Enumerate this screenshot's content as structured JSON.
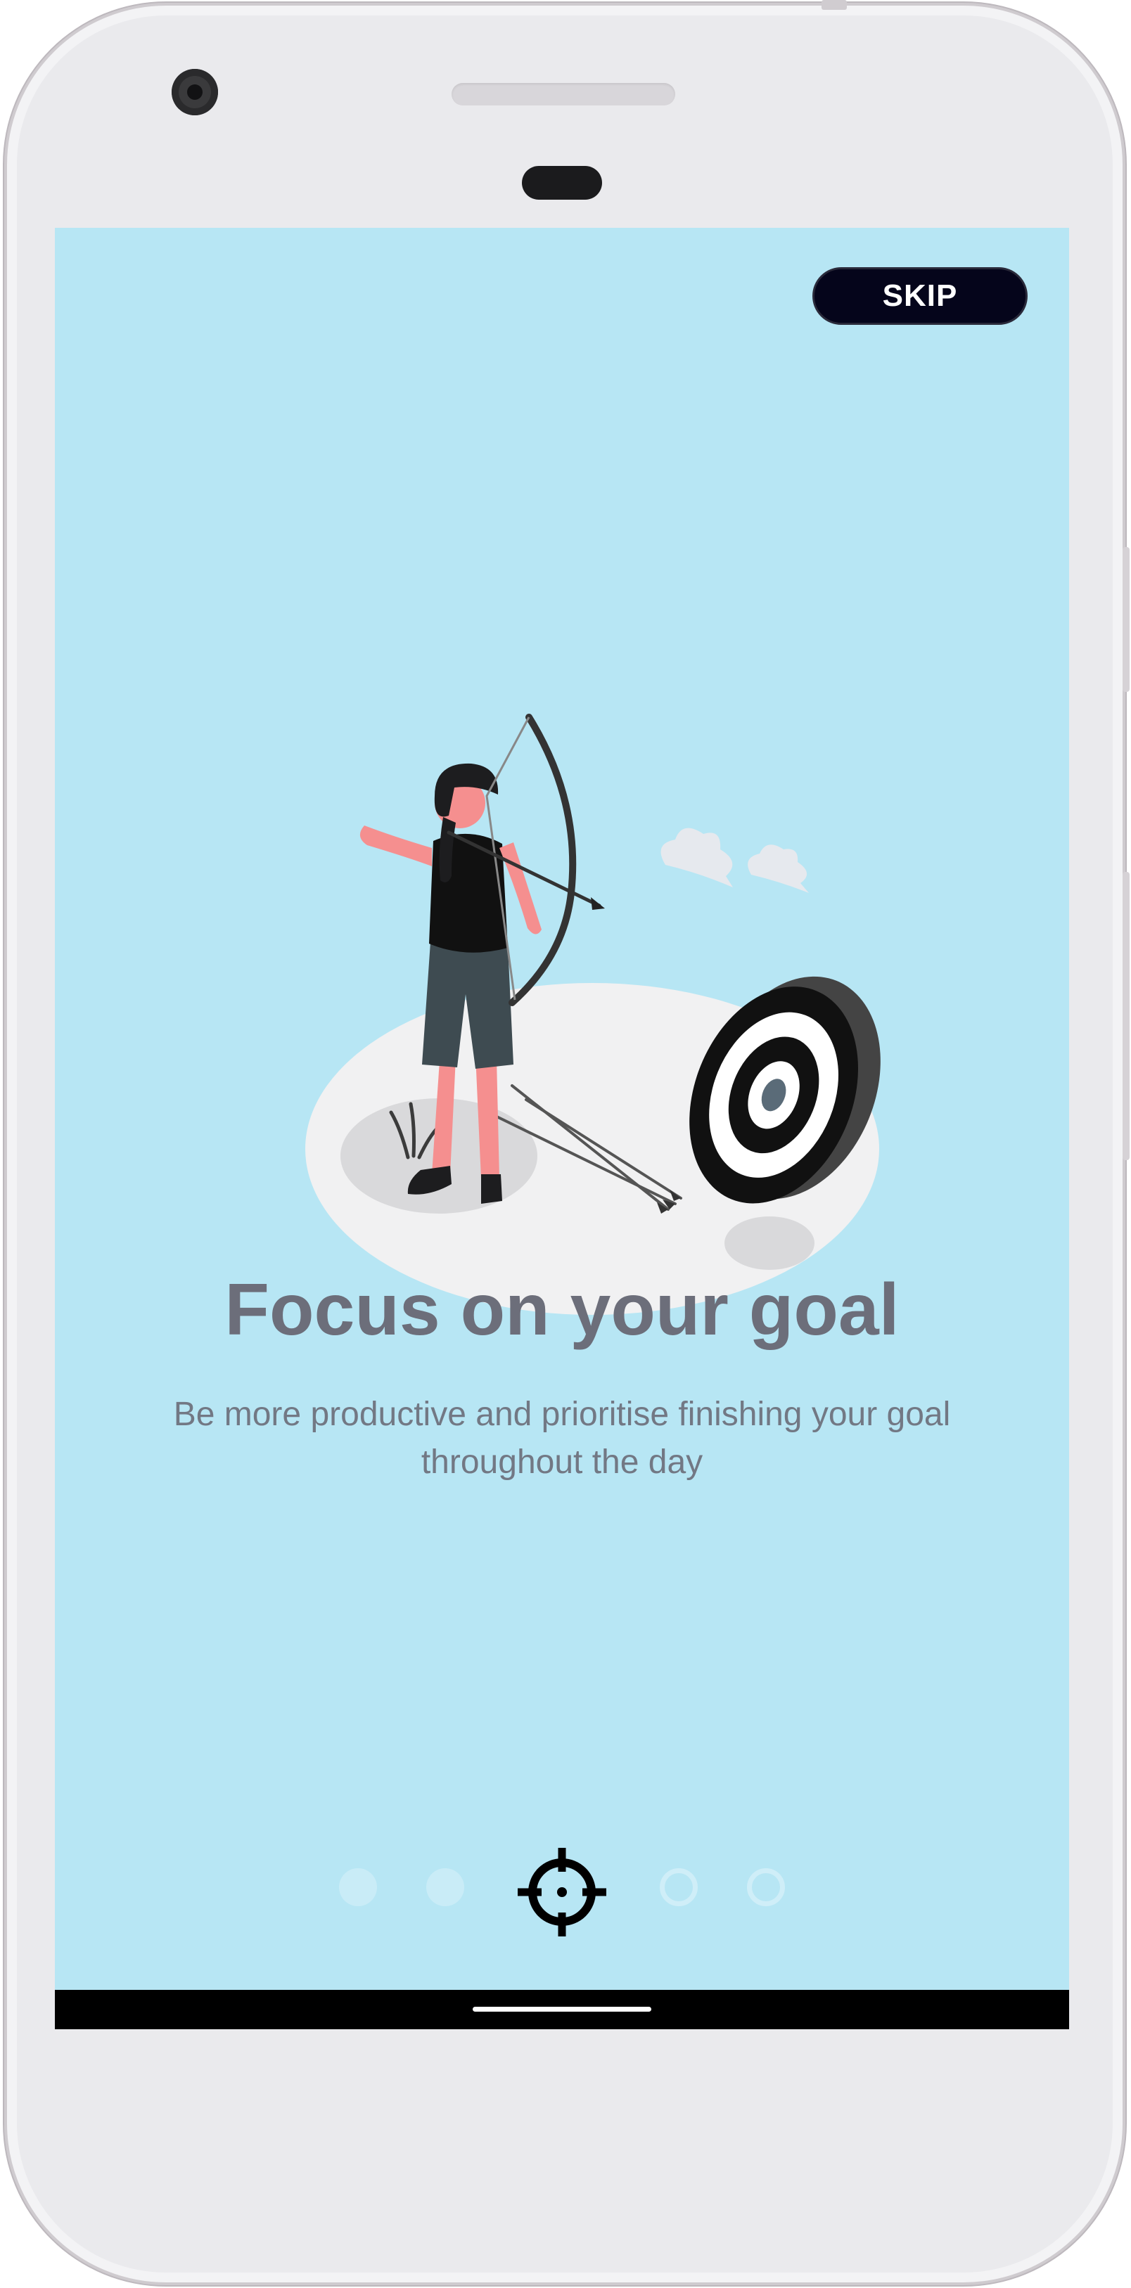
{
  "onboarding": {
    "skip_label": "SKIP",
    "title": "Focus on your goal",
    "subtitle": "Be more productive and prioritise finishing your goal throughout the day",
    "current_page": 3,
    "total_pages": 5,
    "active_indicator_icon": "crosshair-icon"
  },
  "colors": {
    "screen_background": "#b7e6f4",
    "skip_background": "#05051b",
    "title_text": "#6c6e7a",
    "body_text": "#727884"
  }
}
